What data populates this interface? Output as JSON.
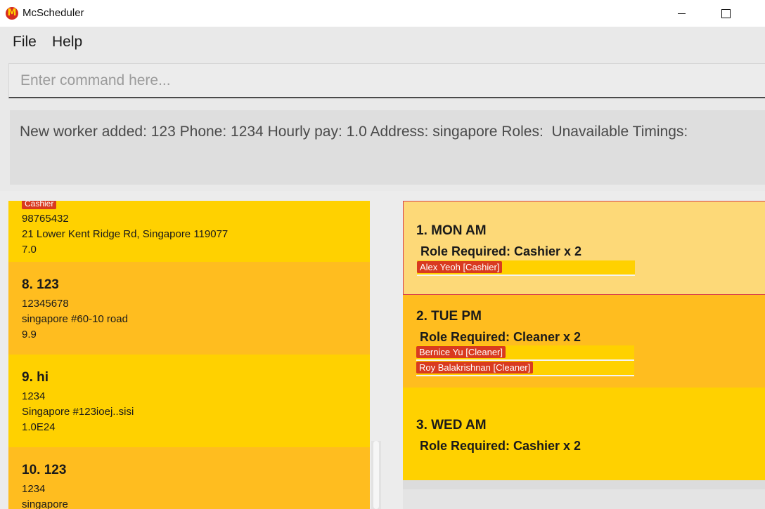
{
  "window": {
    "title": "McScheduler",
    "logo_icon": "m-logo-icon",
    "brand_red": "#d62b1f",
    "brand_yellow": "#ffcf00"
  },
  "menu": {
    "file": "File",
    "help": "Help"
  },
  "command": {
    "placeholder": "Enter command here..."
  },
  "result": {
    "text": "New worker added: 123 Phone: 1234 Hourly pay: 1.0 Address: singapore Roles:  Unavailable Timings:"
  },
  "workers": {
    "partial": {
      "role": "Cashier",
      "phone": "98765432",
      "address": "21 Lower Kent Ridge Rd, Singapore 119077",
      "pay": "7.0"
    },
    "items": [
      {
        "title": "8.  123",
        "phone": "12345678",
        "address": "singapore #60-10 road",
        "pay": "9.9"
      },
      {
        "title": "9.  hi",
        "phone": "1234",
        "address": "Singapore #123ioej..sisi",
        "pay": "1.0E24"
      },
      {
        "title": "10.  123",
        "phone": "1234",
        "address": "singapore"
      }
    ]
  },
  "shifts": [
    {
      "title": "1.  MON AM",
      "role": "Role Required: Cashier x 2",
      "assigned": [
        "Alex Yeoh [Cashier]"
      ]
    },
    {
      "title": "2.  TUE PM",
      "role": "Role Required: Cleaner x 2",
      "assigned": [
        "Bernice Yu [Cleaner]",
        "Roy Balakrishnan [Cleaner]"
      ]
    },
    {
      "title": "3.  WED AM",
      "role": "Role Required: Cashier x 2",
      "assigned": []
    }
  ]
}
